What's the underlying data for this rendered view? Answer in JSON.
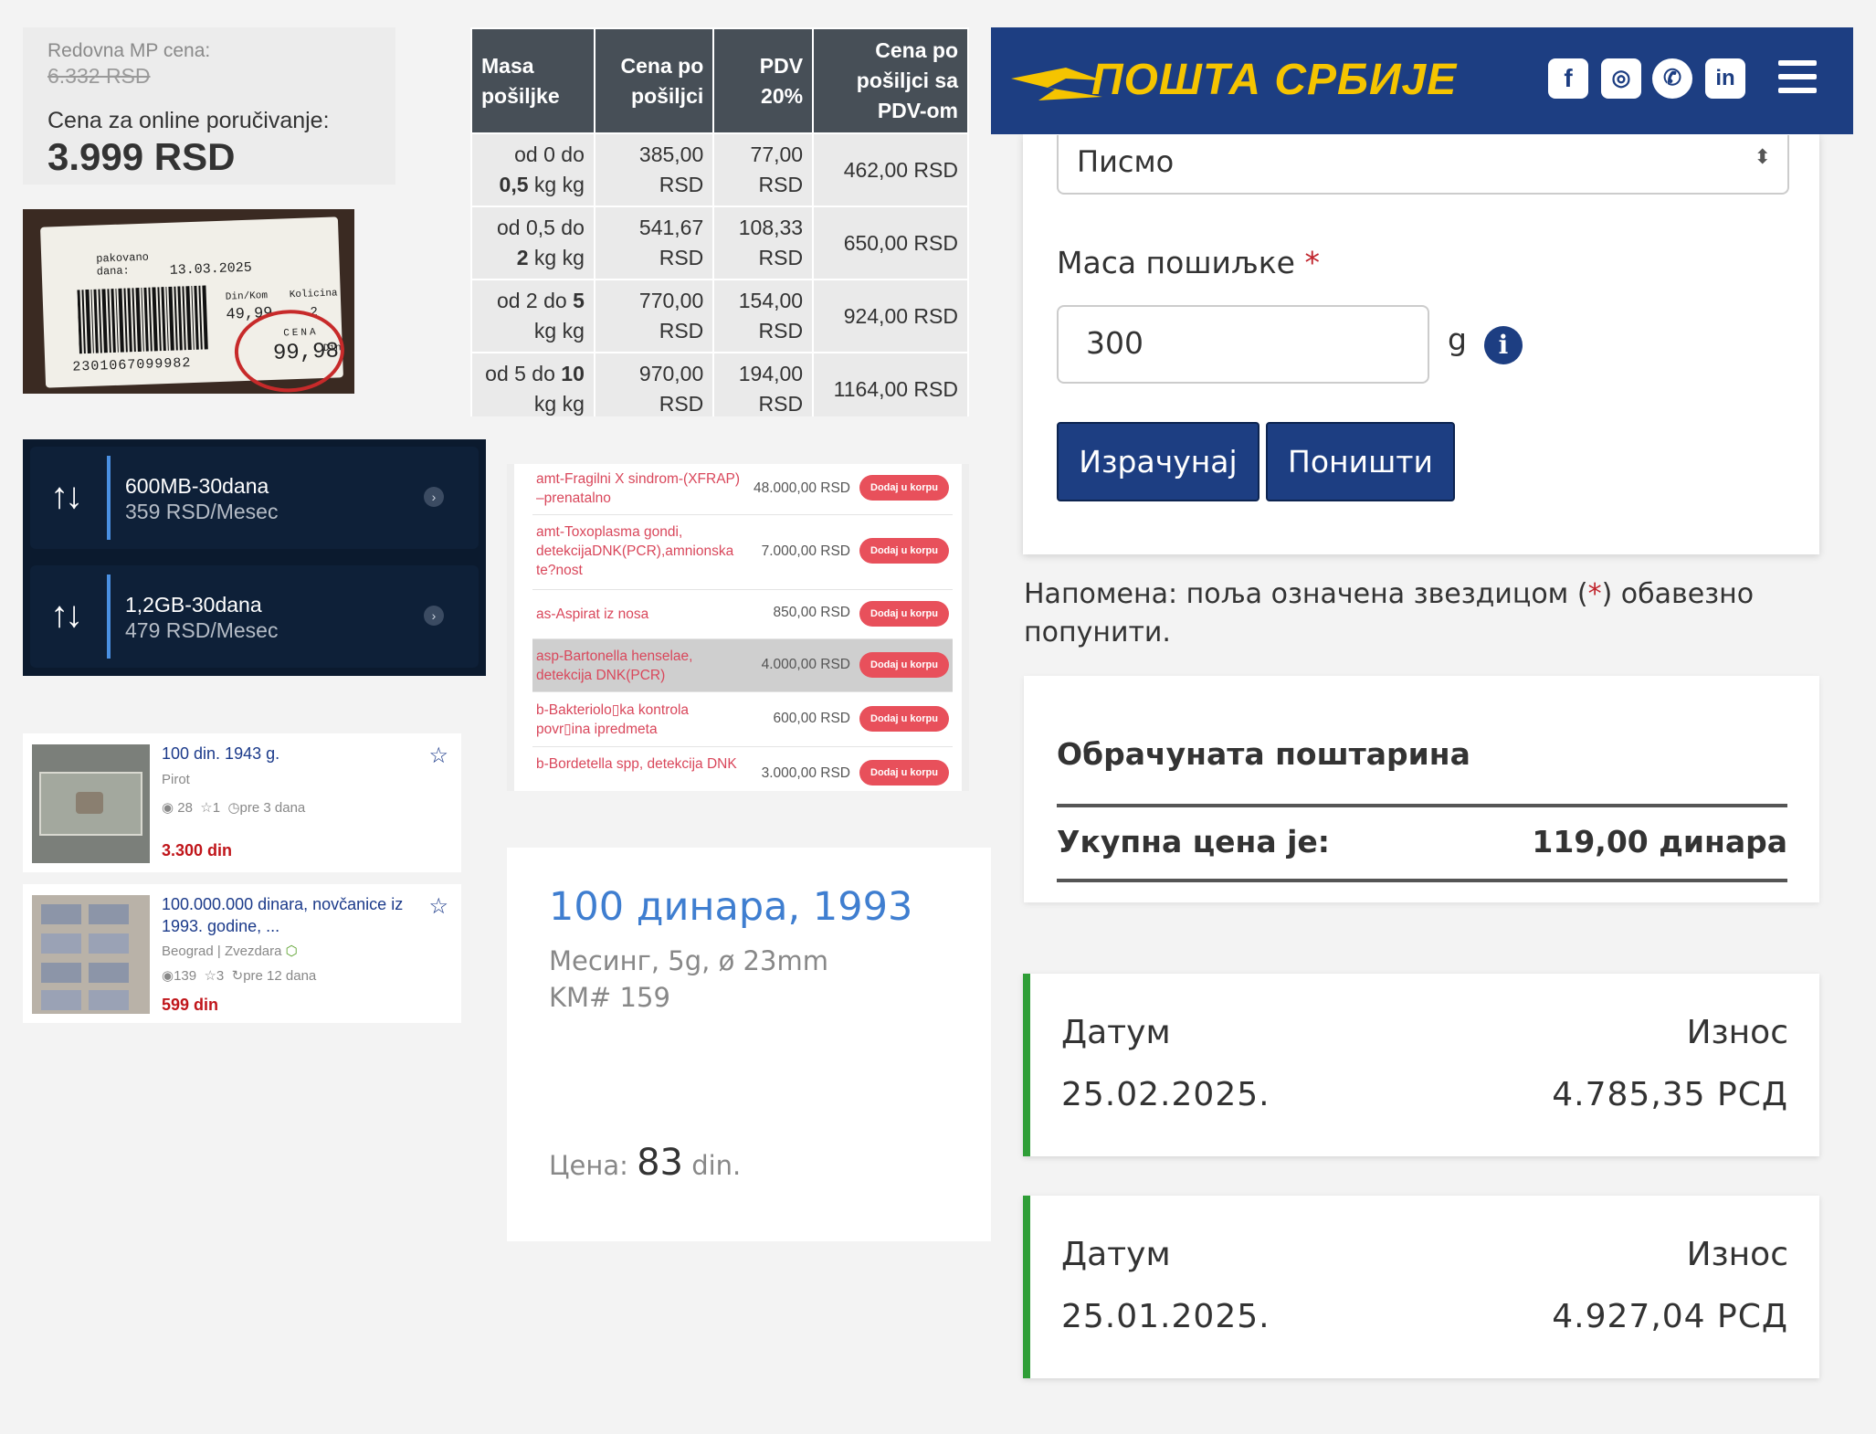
{
  "price_panel": {
    "regular_label": "Redovna MP cena:",
    "regular_value": "6.332 RSD",
    "online_label": "Cena za online poručivanje:",
    "online_value": "3.999 RSD"
  },
  "receipt": {
    "packed_label": "pakovano dana:",
    "date": "13.03.2025",
    "unit_label": "Din/Kom",
    "unit_price": "49,99",
    "qty_label": "Kolicina",
    "qty": "2",
    "price_label": "CENA",
    "total": "99,98",
    "currency": "Din",
    "barcode": "2301067099982"
  },
  "postage_table": {
    "headers": [
      "Masa pošiljke",
      "Cena po pošiljci",
      "PDV 20%",
      "Cena po pošiljci sa PDV-om"
    ],
    "rows": [
      {
        "from": "od 0 do",
        "to": "0,5",
        "unit": "kg kg",
        "price": "385,00 RSD",
        "vat": "77,00 RSD",
        "total": "462,00 RSD"
      },
      {
        "from": "od 0,5 do",
        "to": "2",
        "unit": "kg kg",
        "price": "541,67 RSD",
        "vat": "108,33 RSD",
        "total": "650,00 RSD"
      },
      {
        "from": "od 2 do",
        "to": "5",
        "unit": "kg kg",
        "price": "770,00 RSD",
        "vat": "154,00 RSD",
        "total": "924,00 RSD"
      },
      {
        "from": "od 5 do",
        "to": "10",
        "unit": "kg kg",
        "price": "970,00 RSD",
        "vat": "194,00 RSD",
        "total": "1164,00 RSD"
      }
    ]
  },
  "plans": [
    {
      "name": "600MB-30dana",
      "price": "359 RSD/Mesec"
    },
    {
      "name": "1,2GB-30dana",
      "price": "479 RSD/Mesec"
    }
  ],
  "listings": [
    {
      "title": "100 din. 1943 g.",
      "location": "Pirot",
      "views": "28",
      "favs": "1",
      "age": "pre 3 dana",
      "price": "3.300 din"
    },
    {
      "title": "100.000.000 dinara, novčanice iz 1993. godine, ...",
      "location": "Beograd | Zvezdara",
      "views": "139",
      "favs": "3",
      "age": "pre 12 dana",
      "price": "599 din"
    }
  ],
  "lab": {
    "button_label": "Dodaj u korpu",
    "items": [
      {
        "name": "amt-Fragilni X sindrom-(XFRAP) –prenatalno",
        "price": "48.000,00 RSD"
      },
      {
        "name": "amt-Toxoplasma gondi, detekcijaDNK(PCR),amnionska te?nost",
        "price": "7.000,00 RSD"
      },
      {
        "name": "as-Aspirat iz nosa",
        "price": "850,00 RSD"
      },
      {
        "name": "asp-Bartonella henselae, detekcija DNK(PCR)",
        "price": "4.000,00 RSD"
      },
      {
        "name": "b-Bakteriolo▯ka kontrola povr▯ina ipredmeta",
        "price": "600,00 RSD"
      },
      {
        "name": "b-Bordetella spp, detekcija DNK",
        "price": "3.000,00 RSD"
      }
    ]
  },
  "coin": {
    "title": "100 динара, 1993",
    "desc1": "Месинг, 5g, ø 23mm",
    "desc2": "KM# 159",
    "price_label": "Цена:",
    "price_value": "83",
    "price_unit": "din."
  },
  "post": {
    "logo": "ПОШТА СРБИЈЕ",
    "social": [
      "facebook-icon",
      "instagram-icon",
      "viber-icon",
      "linkedin-icon"
    ],
    "select_value": "Писмо",
    "mass_label": "Маса пошиљке",
    "required_mark": "*",
    "mass_value": "300",
    "mass_unit": "g",
    "calc_button": "Израчунај",
    "reset_button": "Поништи",
    "note_pre": "Напомена: поља означена звездицом (",
    "note_star": "*",
    "note_post": ") обавезно попунити.",
    "result_title": "Обрачуната поштарина",
    "total_label": "Укупна цена је:",
    "total_value": "119,00 динара"
  },
  "payments": [
    {
      "date_label": "Датум",
      "amount_label": "Износ",
      "date": "25.02.2025.",
      "amount": "4.785,35 РСД"
    },
    {
      "date_label": "Датум",
      "amount_label": "Износ",
      "date": "25.01.2025.",
      "amount": "4.927,04 РСД"
    }
  ],
  "colors": {
    "post_blue": "#1d3e82",
    "post_yellow": "#f5c400",
    "lab_red": "#e8505b",
    "pay_green": "#2f9e37"
  }
}
